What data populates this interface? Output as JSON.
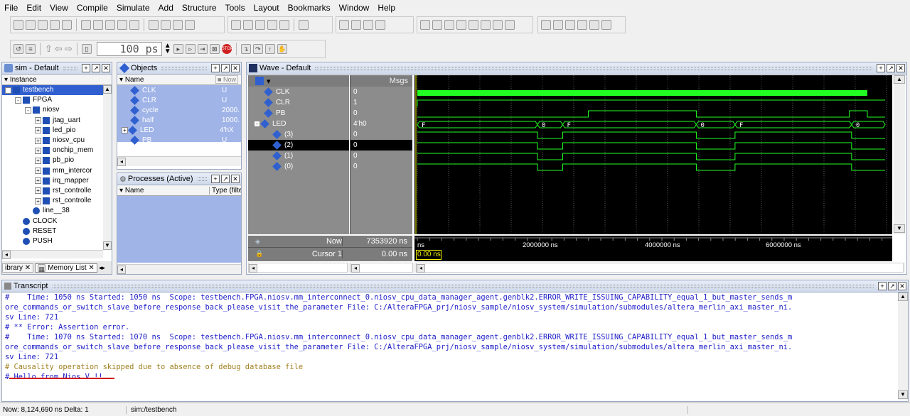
{
  "menu": [
    "File",
    "Edit",
    "View",
    "Compile",
    "Simulate",
    "Add",
    "Structure",
    "Tools",
    "Layout",
    "Bookmarks",
    "Window",
    "Help"
  ],
  "toolbar": {
    "runlength": "100",
    "runlength_unit": "ps"
  },
  "sim": {
    "title": "sim - Default",
    "col": "Instance",
    "tree": [
      {
        "label": "testbench",
        "level": 0,
        "fold": "-",
        "icon": "block",
        "selected": true
      },
      {
        "label": "FPGA",
        "level": 1,
        "fold": "-",
        "icon": "block"
      },
      {
        "label": "niosv",
        "level": 2,
        "fold": "-",
        "icon": "block"
      },
      {
        "label": "jtag_uart",
        "level": 3,
        "fold": "+",
        "icon": "block"
      },
      {
        "label": "led_pio",
        "level": 3,
        "fold": "+",
        "icon": "block"
      },
      {
        "label": "niosv_cpu",
        "level": 3,
        "fold": "+",
        "icon": "block"
      },
      {
        "label": "onchip_mem",
        "level": 3,
        "fold": "+",
        "icon": "block"
      },
      {
        "label": "pb_pio",
        "level": 3,
        "fold": "+",
        "icon": "block"
      },
      {
        "label": "mm_intercor",
        "level": 3,
        "fold": "+",
        "icon": "block"
      },
      {
        "label": "irq_mapper",
        "level": 3,
        "fold": "+",
        "icon": "block"
      },
      {
        "label": "rst_controlle",
        "level": 3,
        "fold": "+",
        "icon": "block"
      },
      {
        "label": "rst_controlle",
        "level": 3,
        "fold": "+",
        "icon": "block"
      },
      {
        "label": "line__38",
        "level": 2,
        "fold": "",
        "icon": "dot"
      },
      {
        "label": "CLOCK",
        "level": 1,
        "fold": "",
        "icon": "dot"
      },
      {
        "label": "RESET",
        "level": 1,
        "fold": "",
        "icon": "dot"
      },
      {
        "label": "PUSH",
        "level": 1,
        "fold": "",
        "icon": "dot"
      }
    ],
    "tabs": [
      "ibrary",
      "Memory List"
    ]
  },
  "objects": {
    "title": "Objects",
    "col_name": "Name",
    "now_label": "Now",
    "rows": [
      {
        "name": "CLK",
        "value": "U",
        "fold": ""
      },
      {
        "name": "CLR",
        "value": "U",
        "fold": ""
      },
      {
        "name": "cycle",
        "value": "2000.",
        "fold": ""
      },
      {
        "name": "half",
        "value": "1000.",
        "fold": ""
      },
      {
        "name": "LED",
        "value": "4'hX",
        "fold": "+"
      },
      {
        "name": "PB",
        "value": "U",
        "fold": ""
      }
    ]
  },
  "processes": {
    "title": "Processes (Active)",
    "col_name": "Name",
    "col_type": "Type (filte"
  },
  "wave": {
    "title": "Wave - Default",
    "msgs": "Msgs",
    "signals": [
      {
        "name": "CLK",
        "value": "0",
        "level": 0,
        "fold": ""
      },
      {
        "name": "CLR",
        "value": "1",
        "level": 0,
        "fold": ""
      },
      {
        "name": "PB",
        "value": "0",
        "level": 0,
        "fold": ""
      },
      {
        "name": "LED",
        "value": "4'h0",
        "level": 0,
        "fold": "-"
      },
      {
        "name": "(3)",
        "value": "0",
        "level": 1,
        "fold": ""
      },
      {
        "name": "(2)",
        "value": "0",
        "level": 1,
        "fold": "",
        "selected": true
      },
      {
        "name": "(1)",
        "value": "0",
        "level": 1,
        "fold": ""
      },
      {
        "name": "(0)",
        "value": "0",
        "level": 1,
        "fold": ""
      }
    ],
    "bus_values": [
      "F",
      "0",
      "F",
      "0",
      "F",
      "0"
    ],
    "now_label": "Now",
    "now_value": "7353920 ns",
    "cursor_label": "Cursor 1",
    "cursor_value": "0.00 ns",
    "cursor_flag": "0.00 ns",
    "time_labels": [
      "ns",
      "2000000 ns",
      "4000000 ns",
      "6000000 ns"
    ],
    "wave_color": "#22ff22"
  },
  "transcript": {
    "title": "Transcript",
    "lines": [
      {
        "text": "#    Time: 1050 ns Started: 1050 ns  Scope: testbench.FPGA.niosv.mm_interconnect_0.niosv_cpu_data_manager_agent.genblk2.ERROR_WRITE_ISSUING_CAPABILITY_equal_1_but_master_sends_m",
        "color": "#2020c8"
      },
      {
        "text": "ore_commands_or_switch_slave_before_response_back_please_visit_the_parameter File: C:/AlteraFPGA_prj/niosv_sample/niosv_system/simulation/submodules/altera_merlin_axi_master_ni.",
        "color": "#2020c8"
      },
      {
        "text": "sv Line: 721",
        "color": "#2020c8"
      },
      {
        "text": "# ** Error: Assertion error.",
        "color": "#2020c8"
      },
      {
        "text": "#    Time: 1070 ns Started: 1070 ns  Scope: testbench.FPGA.niosv.mm_interconnect_0.niosv_cpu_data_manager_agent.genblk2.ERROR_WRITE_ISSUING_CAPABILITY_equal_1_but_master_sends_m",
        "color": "#2020c8"
      },
      {
        "text": "ore_commands_or_switch_slave_before_response_back_please_visit_the_parameter File: C:/AlteraFPGA_prj/niosv_sample/niosv_system/simulation/submodules/altera_merlin_axi_master_ni.",
        "color": "#2020c8"
      },
      {
        "text": "sv Line: 721",
        "color": "#2020c8"
      },
      {
        "text": "# Causality operation skipped due to absence of debug database file",
        "color": "#a08020"
      },
      {
        "text": "# Hello from Nios V !!",
        "color": "#2020c8"
      }
    ]
  },
  "status": {
    "now": "Now: 8,124,690 ns  Delta: 1",
    "path": "sim:/testbench"
  }
}
